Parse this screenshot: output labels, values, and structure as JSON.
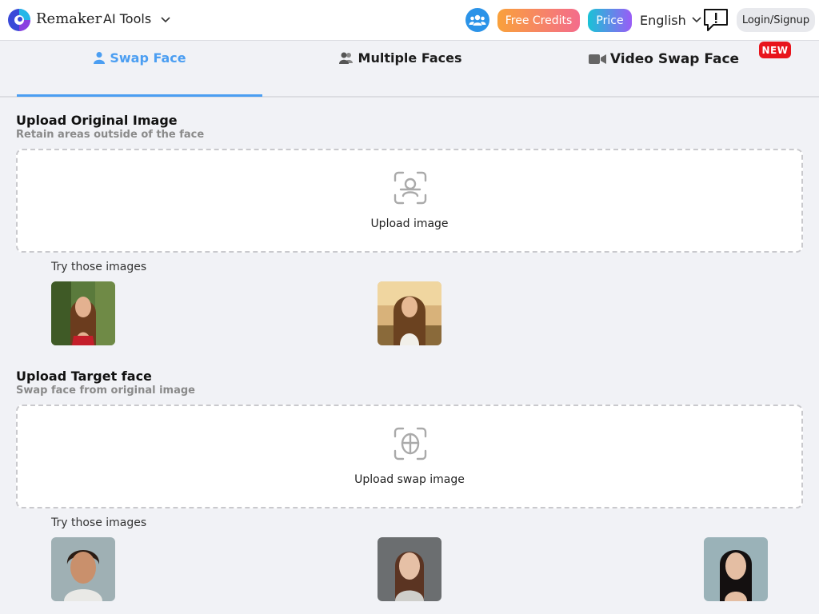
{
  "header": {
    "brand": "Remaker",
    "ai_tools": "AI Tools",
    "free_credits": "Free Credits",
    "price": "Price",
    "language": "English",
    "login": "Login/Signup"
  },
  "tabs": [
    {
      "label": "Swap Face",
      "icon": "user-icon",
      "active": true
    },
    {
      "label": "Multiple Faces",
      "icon": "users-icon",
      "active": false
    },
    {
      "label": "Video Swap Face",
      "icon": "video-camera-icon",
      "active": false,
      "badge": "NEW"
    }
  ],
  "original": {
    "title": "Upload Original Image",
    "subtitle": "Retain areas outside of the face",
    "upload_label": "Upload image",
    "try_label": "Try those images"
  },
  "target": {
    "title": "Upload Target face",
    "subtitle": "Swap face from original image",
    "upload_label": "Upload swap image",
    "try_label": "Try those images"
  },
  "colors": {
    "accent": "#4b9ef2",
    "badge": "#e8141c",
    "free_credits_from": "#f9a13b",
    "free_credits_to": "#f46c8c",
    "price_from": "#19c3d6",
    "price_to": "#9a5cf6"
  }
}
